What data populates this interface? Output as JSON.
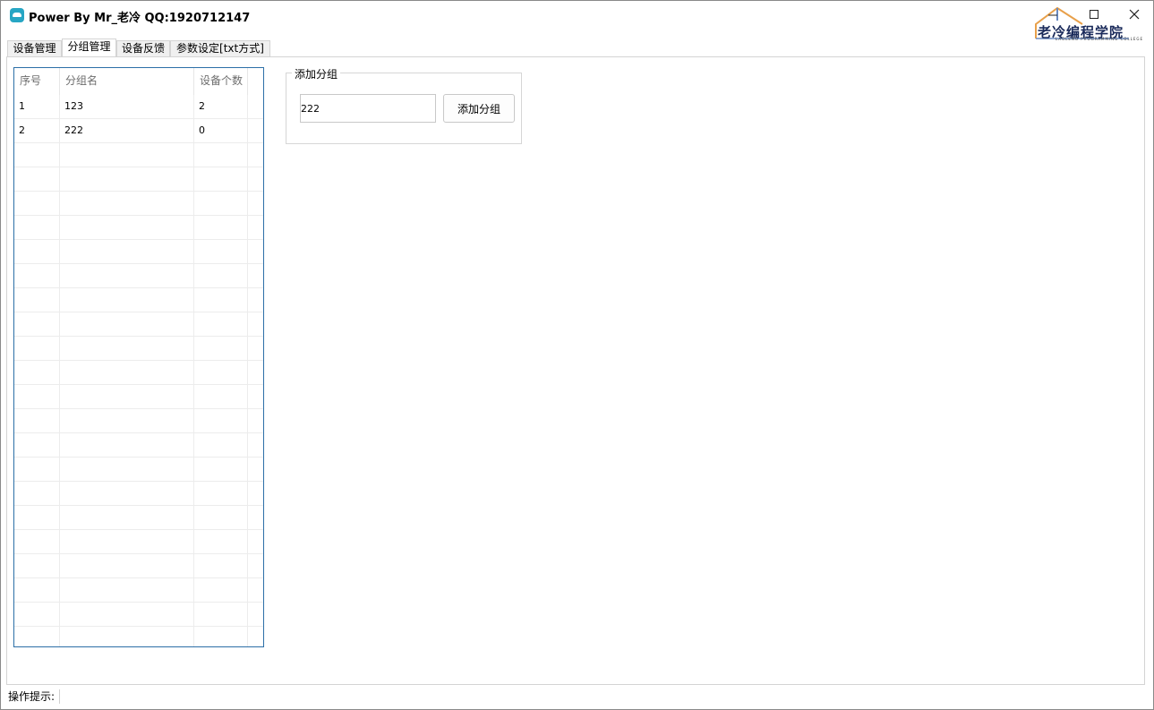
{
  "window": {
    "title": "Power By Mr_老冷 QQ:1920712147",
    "logo_text": "老冷编程学院",
    "logo_sub": "LAOLENG PROGRAMMING COLLEGE"
  },
  "tabs": [
    {
      "label": "设备管理"
    },
    {
      "label": "分组管理"
    },
    {
      "label": "设备反馈"
    },
    {
      "label": "参数设定[txt方式]"
    }
  ],
  "active_tab": "分组管理",
  "table": {
    "columns": [
      "序号",
      "分组名",
      "设备个数"
    ],
    "rows": [
      {
        "id": "1",
        "name": "123",
        "count": "2"
      },
      {
        "id": "2",
        "name": "222",
        "count": "0"
      }
    ]
  },
  "add_group": {
    "title": "添加分组",
    "input_value": "222",
    "button_label": "添加分组"
  },
  "status": {
    "label": "操作提示:"
  },
  "colors": {
    "grid_border": "#2c6fa7",
    "app_icon": "#27a6c4"
  }
}
